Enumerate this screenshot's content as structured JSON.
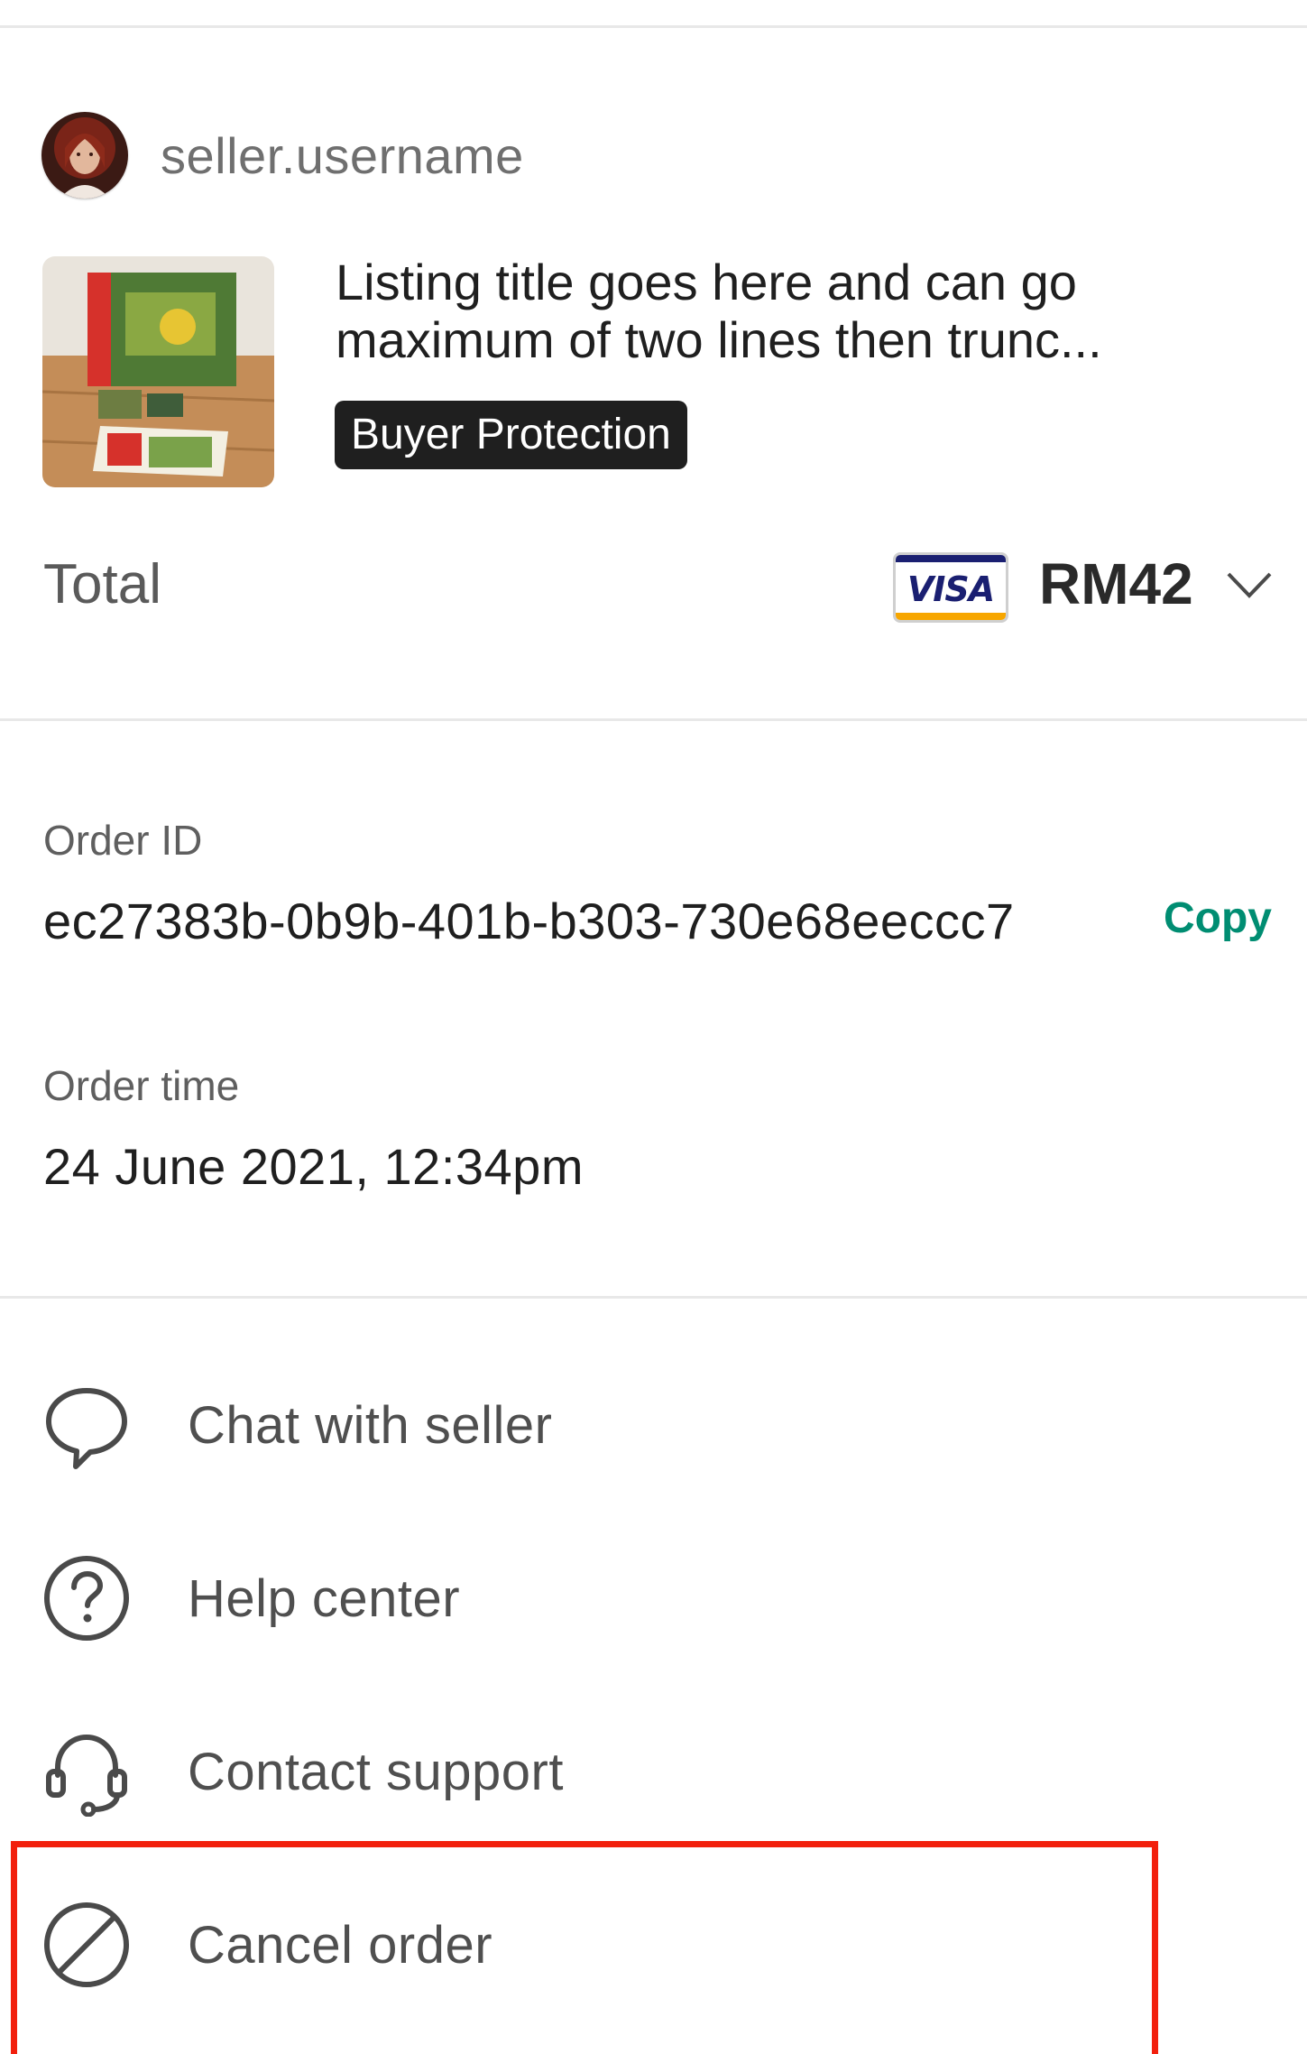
{
  "seller": {
    "username": "seller.username"
  },
  "listing": {
    "title": "Listing title goes here and can go maximum of two lines then trunc...",
    "badge": "Buyer Protection"
  },
  "total": {
    "label": "Total",
    "payment_brand": "VISA",
    "amount": "RM42"
  },
  "order": {
    "id_label": "Order ID",
    "id_value": "ec27383b-0b9b-401b-b303-730e68eeccc7",
    "copy_label": "Copy",
    "time_label": "Order time",
    "time_value": "24 June 2021, 12:34pm"
  },
  "actions": [
    {
      "label": "Chat with seller",
      "icon": "chat-bubble-icon"
    },
    {
      "label": "Help center",
      "icon": "question-circle-icon"
    },
    {
      "label": "Contact support",
      "icon": "headset-icon"
    },
    {
      "label": "Cancel order",
      "icon": "cancel-circle-icon"
    }
  ],
  "colors": {
    "accent_green": "#008d72",
    "highlight_red": "#f2200d",
    "badge_bg": "#1f1f1f",
    "visa_blue": "#1a1f71",
    "visa_gold": "#f7a600"
  }
}
